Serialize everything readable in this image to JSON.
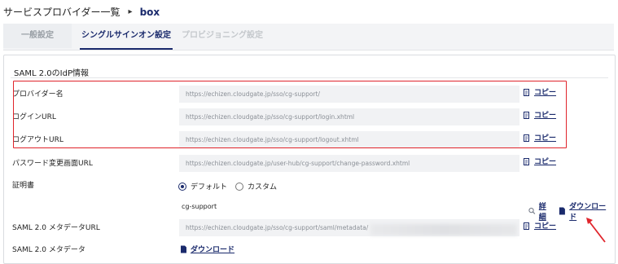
{
  "breadcrumb": {
    "parent": "サービスプロバイダー一覧",
    "separator": "▸",
    "current": "box"
  },
  "tabs": [
    {
      "label": "一般設定",
      "state": "inactive"
    },
    {
      "label": "シングルサインオン設定",
      "state": "active"
    },
    {
      "label": "プロビジョニング設定",
      "state": "disabled"
    }
  ],
  "section": {
    "title": "SAML 2.0のIdP情報"
  },
  "rows": {
    "provider_name": {
      "label": "プロバイダー名",
      "value": "https://echizen.cloudgate.jp/sso/cg-support/",
      "copy": "コピー"
    },
    "login_url": {
      "label": "ログインURL",
      "value": "https://echizen.cloudgate.jp/sso/cg-support/login.xhtml",
      "copy": "コピー"
    },
    "logout_url": {
      "label": "ログアウトURL",
      "value": "https://echizen.cloudgate.jp/sso/cg-support/logout.xhtml",
      "copy": "コピー"
    },
    "password_url": {
      "label": "パスワード変更画面URL",
      "value": "https://echizen.cloudgate.jp/user-hub/cg-support/change-password.xhtml",
      "copy": "コピー"
    },
    "certificate": {
      "label": "証明書",
      "options": [
        "デフォルト",
        "カスタム"
      ],
      "selected": "デフォルト",
      "name": "cg-support",
      "details": "詳細",
      "download": "ダウンロード"
    },
    "metadata_url": {
      "label": "SAML 2.0 メタデータURL",
      "value": "https://echizen.cloudgate.jp/sso/cg-support/saml/metadata/",
      "copy": "コピー"
    },
    "metadata": {
      "label": "SAML 2.0 メタデータ",
      "download": "ダウンロード"
    }
  },
  "icons": {
    "copy": "copy-icon",
    "details": "search-icon",
    "download": "document-icon"
  },
  "colors": {
    "link": "#1a2a6c",
    "highlight": "#e0242b",
    "value_bg": "#f1f2f4"
  }
}
